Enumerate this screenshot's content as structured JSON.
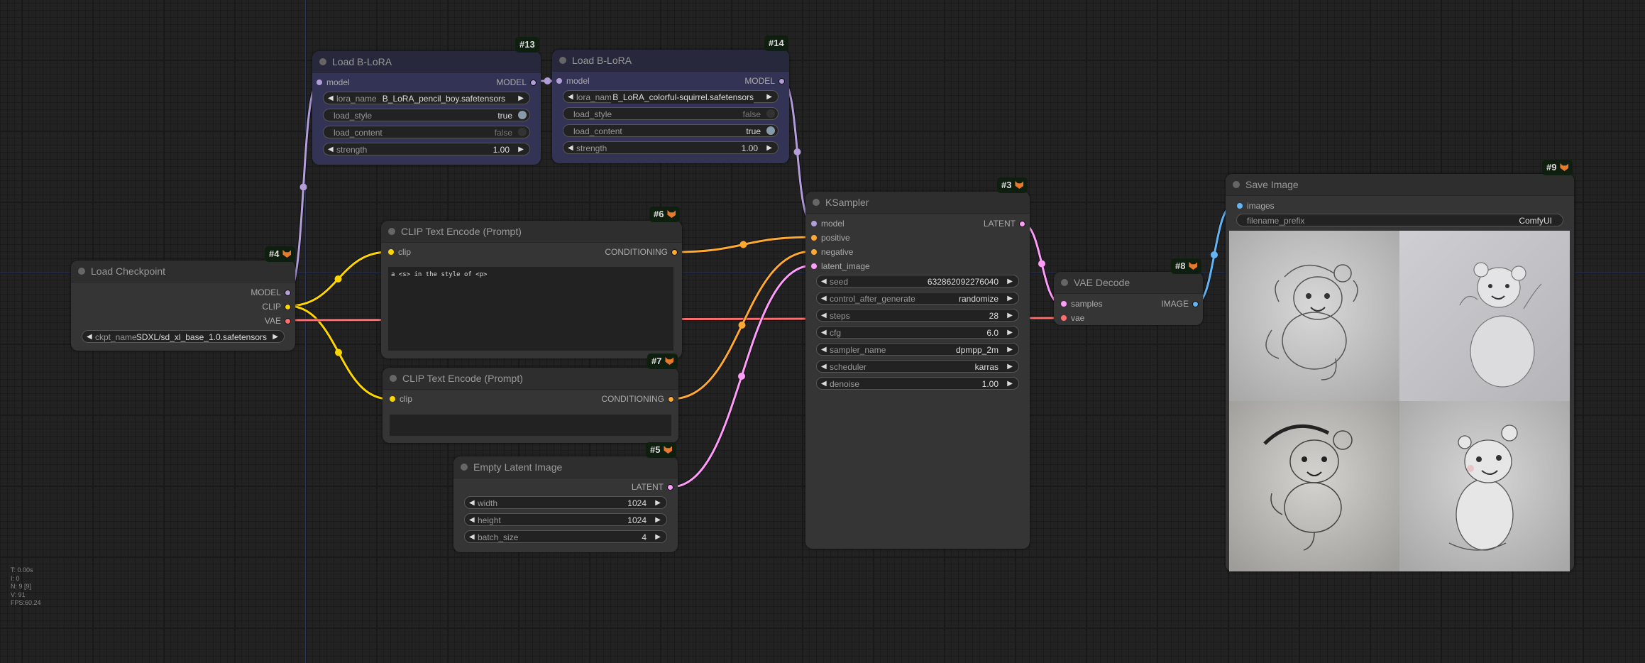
{
  "colors": {
    "model": "#b39ddb",
    "clip": "#ffd500",
    "vae": "#ff6e6e",
    "conditioning": "#ffa931",
    "latent": "#ff9cf9",
    "image": "#64b5f6",
    "lora_node_bg": "#333355",
    "node_bg": "#353535",
    "canvas_bg": "#222222"
  },
  "nodes": {
    "load_checkpoint": {
      "id": "#4",
      "title": "Load Checkpoint",
      "outputs": [
        "MODEL",
        "CLIP",
        "VAE"
      ],
      "ckpt_name": {
        "label": "ckpt_name",
        "value": "SDXL/sd_xl_base_1.0.safetensors"
      }
    },
    "lora13": {
      "id": "#13",
      "title": "Load B-LoRA",
      "input": "model",
      "output": "MODEL",
      "lora_name": {
        "label": "lora_name",
        "value": "B_LoRA_pencil_boy.safetensors"
      },
      "load_style": {
        "label": "load_style",
        "value": "true"
      },
      "load_content": {
        "label": "load_content",
        "value": "false"
      },
      "strength": {
        "label": "strength",
        "value": "1.00"
      }
    },
    "lora14": {
      "id": "#14",
      "title": "Load B-LoRA",
      "input": "model",
      "output": "MODEL",
      "lora_name": {
        "label": "lora_name",
        "value": "B_LoRA_colorful-squirrel.safetensors"
      },
      "load_style": {
        "label": "load_style",
        "value": "false"
      },
      "load_content": {
        "label": "load_content",
        "value": "true"
      },
      "strength": {
        "label": "strength",
        "value": "1.00"
      }
    },
    "clip6": {
      "id": "#6",
      "title": "CLIP Text Encode (Prompt)",
      "input": "clip",
      "output": "CONDITIONING",
      "text": "a <s> in the style of <p>"
    },
    "clip7": {
      "id": "#7",
      "title": "CLIP Text Encode (Prompt)",
      "input": "clip",
      "output": "CONDITIONING",
      "text": ""
    },
    "empty_latent": {
      "id": "#5",
      "title": "Empty Latent Image",
      "output": "LATENT",
      "width": {
        "label": "width",
        "value": "1024"
      },
      "height": {
        "label": "height",
        "value": "1024"
      },
      "batch_size": {
        "label": "batch_size",
        "value": "4"
      }
    },
    "ksampler": {
      "id": "#3",
      "title": "KSampler",
      "inputs": [
        "model",
        "positive",
        "negative",
        "latent_image"
      ],
      "output": "LATENT",
      "widgets": [
        {
          "label": "seed",
          "value": "632862092276040"
        },
        {
          "label": "control_after_generate",
          "value": "randomize"
        },
        {
          "label": "steps",
          "value": "28"
        },
        {
          "label": "cfg",
          "value": "6.0"
        },
        {
          "label": "sampler_name",
          "value": "dpmpp_2m"
        },
        {
          "label": "scheduler",
          "value": "karras"
        },
        {
          "label": "denoise",
          "value": "1.00"
        }
      ]
    },
    "vae_decode": {
      "id": "#8",
      "title": "VAE Decode",
      "inputs": [
        "samples",
        "vae"
      ],
      "output": "IMAGE"
    },
    "save_image": {
      "id": "#9",
      "title": "Save Image",
      "input": "images",
      "filename_prefix": {
        "label": "filename_prefix",
        "value": "ComfyUI"
      },
      "preview_images": [
        "pencil-drawing-creature-1",
        "pencil-drawing-creature-2",
        "pencil-drawing-creature-3",
        "pencil-drawing-creature-4"
      ]
    }
  },
  "stats": {
    "t": "T: 0.00s",
    "i": "I: 0",
    "n": "N: 9 [9]",
    "v": "V: 91",
    "fps": "FPS:60.24"
  }
}
